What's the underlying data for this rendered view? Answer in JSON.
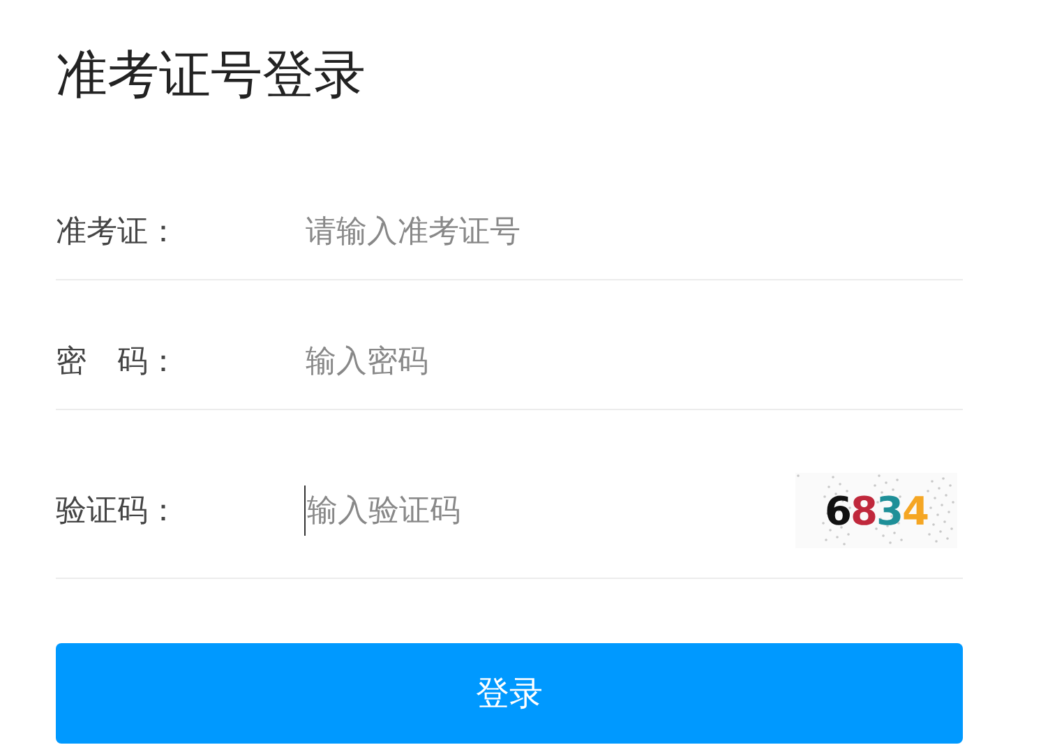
{
  "title": "准考证号登录",
  "fields": [
    {
      "label": "准考证：",
      "placeholder": "请输入准考证号",
      "focused": false
    },
    {
      "label": "密　码：",
      "placeholder": "输入密码",
      "focused": false
    },
    {
      "label": "验证码：",
      "placeholder": "输入验证码",
      "focused": true,
      "captcha": [
        {
          "text": "6",
          "color": "#111111"
        },
        {
          "text": "8",
          "color": "#c0283c"
        },
        {
          "text": "3",
          "color": "#1e8f98"
        },
        {
          "text": "4",
          "color": "#f5a623"
        }
      ]
    }
  ],
  "button": "登录"
}
